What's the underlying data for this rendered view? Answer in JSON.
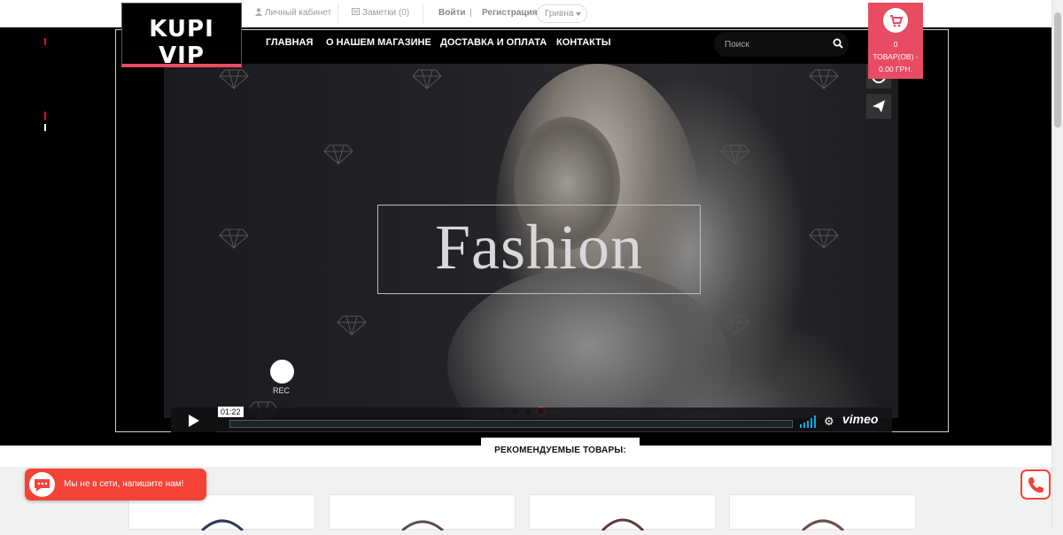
{
  "topbar": {
    "account_label": "Личный кабинет",
    "notes_label": "Заметки (0)",
    "login_label": "Войти",
    "separator": "|",
    "register_label": "Регистрация",
    "currency_selected": "Гривна"
  },
  "logo": {
    "text": "KUPI VIP"
  },
  "nav": {
    "items": [
      {
        "label": "ГЛАВНАЯ"
      },
      {
        "label": "О НАШЕМ МАГАЗИНЕ"
      },
      {
        "label": "ДОСТАВКА И ОПЛАТА"
      },
      {
        "label": "КОНТАКТЫ"
      }
    ]
  },
  "search": {
    "placeholder": "Поиск",
    "icon": "search-icon"
  },
  "cart": {
    "count": "0",
    "line1": "ТОВАР(ОВ) -",
    "line2": "0.00 ГРН.",
    "icon": "cart-icon"
  },
  "video": {
    "overlay_title": "Fashion",
    "rec_label": "REC",
    "timecode": "01:22",
    "brand": "vimeo",
    "slide_count": 4,
    "active_slide": 4
  },
  "recommended": {
    "title": "РЕКОМЕНДУЕМЫЕ ТОВАРЫ:"
  },
  "chat": {
    "text": "Мы не в сети, напишите нам!",
    "icon": "chat-bubble-icon"
  },
  "phone": {
    "icon": "phone-icon"
  },
  "colors": {
    "accent": "#e84c63",
    "chat": "#f44336",
    "hero_bg": "#000000"
  }
}
